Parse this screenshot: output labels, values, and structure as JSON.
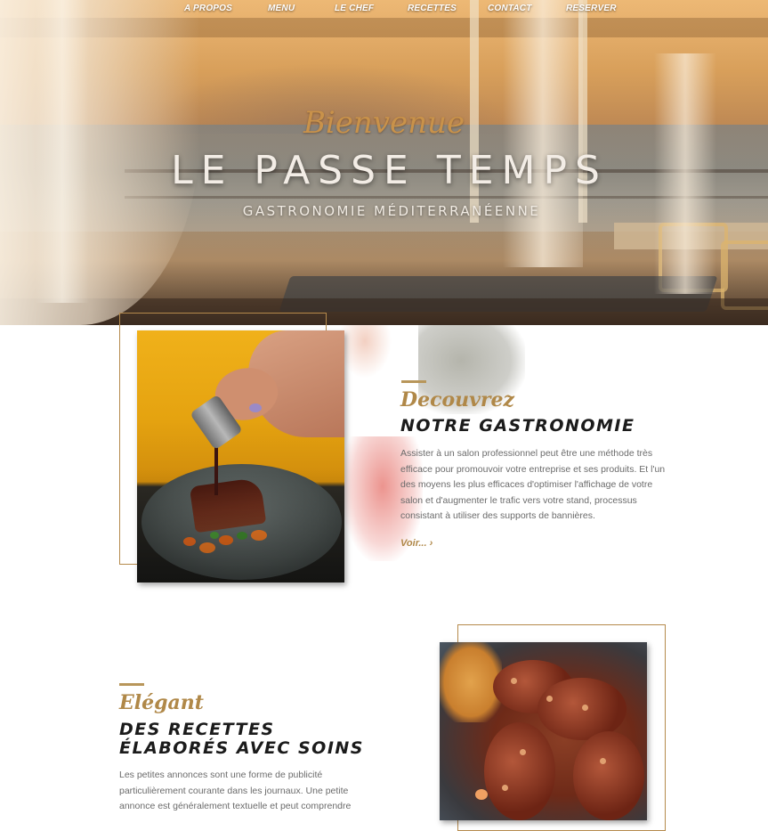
{
  "nav": {
    "items": [
      "A PROPOS",
      "MENU",
      "LE CHEF",
      "RECETTES",
      "CONTACT",
      "RESERVER"
    ]
  },
  "hero": {
    "script": "Bienvenue",
    "title": "LE PASSE TEMPS",
    "subtitle": "GASTRONOMIE MÉDITERRANÉENNE"
  },
  "section1": {
    "script": "Decouvrez",
    "heading": "NOTRE GASTRONOMIE",
    "body_lines": [
      "Assister à un salon professionnel peut être une méthode très",
      "efficace pour promouvoir votre entreprise et ses produits. Et l'un",
      "des moyens les plus efficaces d'optimiser l'affichage de votre",
      "salon et d'augmenter le trafic vers votre stand, processus",
      "consistant à utiliser des supports de bannières."
    ],
    "link": "Voir..."
  },
  "section2": {
    "script": "Elégant",
    "heading_line1": "DES RECETTES",
    "heading_line2": "ÉLABORÉS AVEC SOINS",
    "body_lines": [
      "Les petites annonces sont une forme de publicité",
      "particulièrement courante dans les journaux. Une petite",
      "annonce est généralement textuelle et peut comprendre"
    ]
  },
  "colors": {
    "accent_gold": "#b08848",
    "heading_dark": "#1b1b1b",
    "body_gray": "#6b6b6b"
  }
}
